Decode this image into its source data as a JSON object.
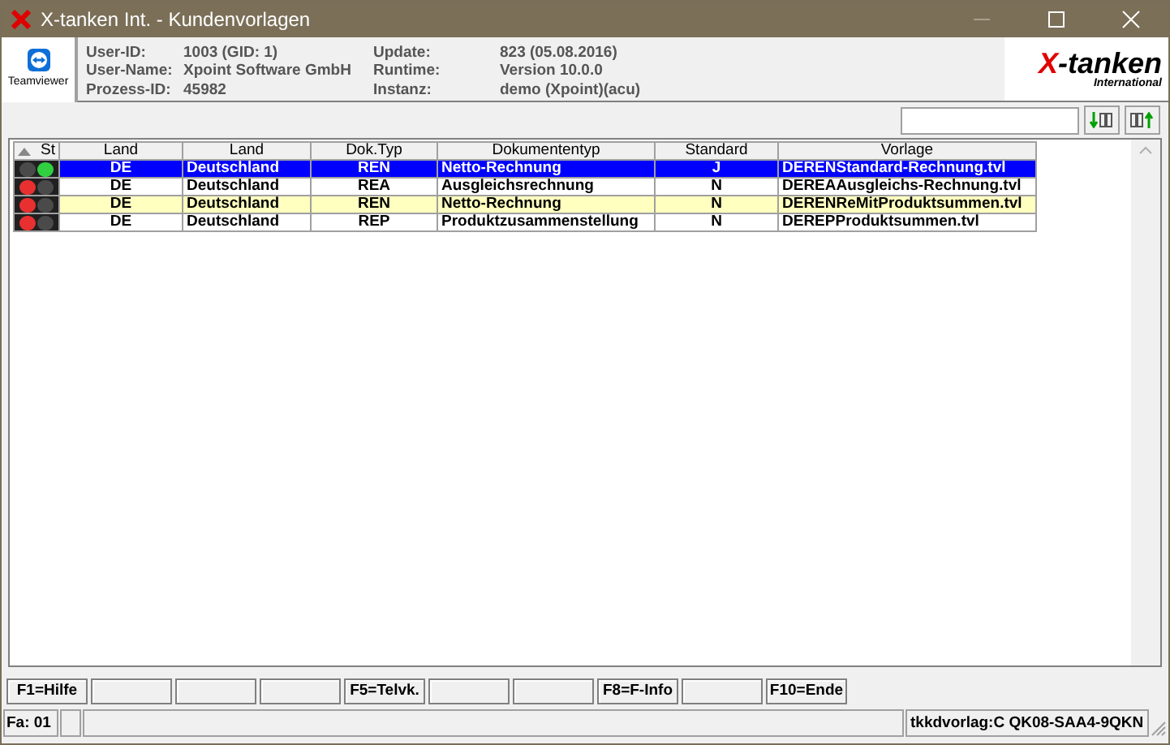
{
  "window": {
    "title": "X-tanken Int. - Kundenvorlagen"
  },
  "header": {
    "teamviewer_label": "Teamviewer",
    "info": [
      {
        "label": "User-ID:",
        "value": "1003 (GID: 1)"
      },
      {
        "label": "User-Name:",
        "value": "Xpoint Software GmbH"
      },
      {
        "label": "Prozess-ID:",
        "value": "45982"
      },
      {
        "label": "Update:",
        "value": "823 (05.08.2016)"
      },
      {
        "label": "Runtime:",
        "value": "Version 10.0.0"
      },
      {
        "label": "Instanz:",
        "value": "demo (Xpoint)(acu)"
      }
    ],
    "logo": {
      "brand_x": "X",
      "brand_rest": "-tanken",
      "subtitle": "International"
    }
  },
  "table": {
    "status_header": "St",
    "columns": [
      "Land",
      "Land",
      "Dok.Typ",
      "Dokumententyp",
      "Standard",
      "Vorlage"
    ],
    "rows": [
      {
        "selected": true,
        "highlighted": false,
        "red_on": false,
        "green_on": true,
        "cells": [
          "DE",
          "Deutschland",
          "REN",
          "Netto-Rechnung",
          "J",
          "DERENStandard-Rechnung.tvl"
        ]
      },
      {
        "selected": false,
        "highlighted": false,
        "red_on": true,
        "green_on": false,
        "cells": [
          "DE",
          "Deutschland",
          "REA",
          "Ausgleichsrechnung",
          "N",
          "DEREAAusgleichs-Rechnung.tvl"
        ]
      },
      {
        "selected": false,
        "highlighted": true,
        "red_on": true,
        "green_on": false,
        "cells": [
          "DE",
          "Deutschland",
          "REN",
          "Netto-Rechnung",
          "N",
          "DERENReMitProduktsummen.tvl"
        ]
      },
      {
        "selected": false,
        "highlighted": false,
        "red_on": true,
        "green_on": false,
        "cells": [
          "DE",
          "Deutschland",
          "REP",
          "Produktzusammenstellung",
          "N",
          "DEREPProduktsummen.tvl"
        ]
      }
    ]
  },
  "function_keys": [
    {
      "kind": "key",
      "label": "F1=Hilfe"
    },
    {
      "kind": "blank"
    },
    {
      "kind": "blank"
    },
    {
      "kind": "blank"
    },
    {
      "kind": "key",
      "label": "F5=Telvk."
    },
    {
      "kind": "blank"
    },
    {
      "kind": "blank"
    },
    {
      "kind": "key",
      "label": "F8=F-Info"
    },
    {
      "kind": "blank"
    },
    {
      "kind": "key",
      "label": "F10=Ende"
    }
  ],
  "status_bar": {
    "left": "Fa: 01",
    "right": "tkkdvorlag:C QK08-SAA4-9QKN"
  }
}
